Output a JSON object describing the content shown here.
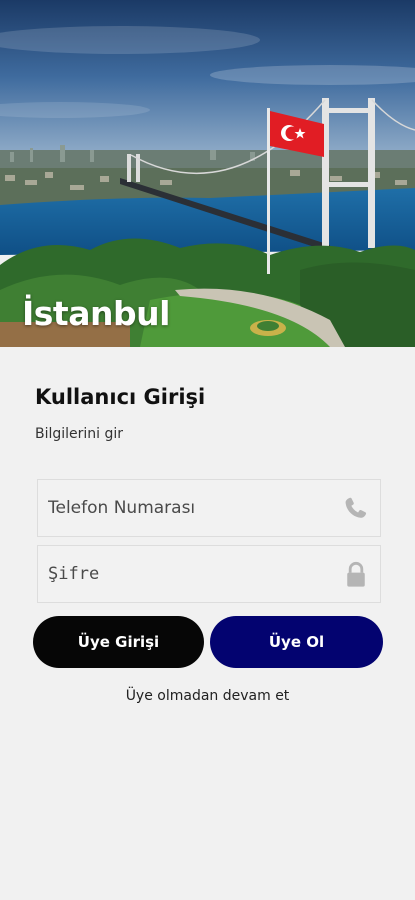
{
  "hero": {
    "title": "İstanbul",
    "image_icon": "istanbul-bosphorus-bridge-photo"
  },
  "login": {
    "title": "Kullanıcı Girişi",
    "subtitle": "Bilgilerini gir",
    "phone_placeholder": "Telefon Numarası",
    "phone_icon": "phone-icon",
    "password_placeholder": "Şifre",
    "password_icon": "lock-icon",
    "login_button": "Üye Girişi",
    "register_button": "Üye Ol",
    "guest_link": "Üye olmadan devam et"
  },
  "colors": {
    "background": "#f1f1f1",
    "login_button": "#060606",
    "register_button": "#030370",
    "icon_gray": "#b5b5b5"
  }
}
